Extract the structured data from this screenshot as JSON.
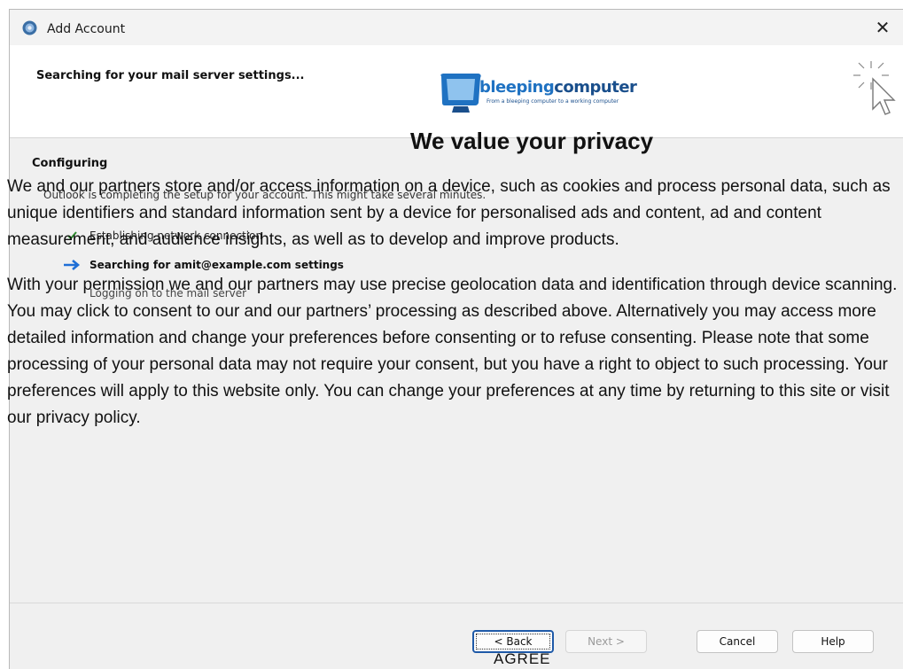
{
  "window": {
    "title": "Add Account",
    "header_title": "Searching for your mail server settings...",
    "close_glyph": "✕"
  },
  "body": {
    "section_title": "Configuring",
    "status_line": "Outlook is completing the setup for your account. This might take several minutes.",
    "steps": [
      {
        "icon": "checkmark-icon",
        "label": "Establishing network connection"
      },
      {
        "icon": "arrow-right-icon",
        "label": "Searching for amit@example.com settings"
      },
      {
        "icon": "none",
        "label": "Logging on to the mail server"
      }
    ]
  },
  "footer": {
    "back_label": "< Back",
    "next_label": "Next >",
    "cancel_label": "Cancel",
    "help_label": "Help"
  },
  "overlay": {
    "logo": {
      "word1": "bleeping",
      "word2": "computer",
      "tagline": "From a bleeping computer to a working computer"
    },
    "title": "We value your privacy",
    "paragraph1_lines": [
      "We and our partners store and/or access information on a device, such as cookies and process personal data, such as",
      "unique identifiers and standard information sent by a device for personalised ads and content, ad and content",
      "measurement, and audience insights, as well as to develop and improve products."
    ],
    "paragraph2_lines": [
      "With your permission we and our partners may use precise geolocation data and identification through device scanning.",
      "You may click to consent to our and our partners’ processing as described above. Alternatively you may access more",
      "detailed information and change your preferences before consenting or to refuse consenting. Please note that some",
      "processing of your personal data may not require your consent, but you have a right to object to such processing. Your",
      "preferences will apply to this website only. You can change your preferences at any time by returning to this site or visit",
      "our privacy policy."
    ],
    "agree_label": "AGREE"
  },
  "colors": {
    "window_bg": "#f0f0f0",
    "header_bg": "#ffffff",
    "focus_border": "#1f5aa8",
    "logo_blue": "#1f72c2"
  }
}
